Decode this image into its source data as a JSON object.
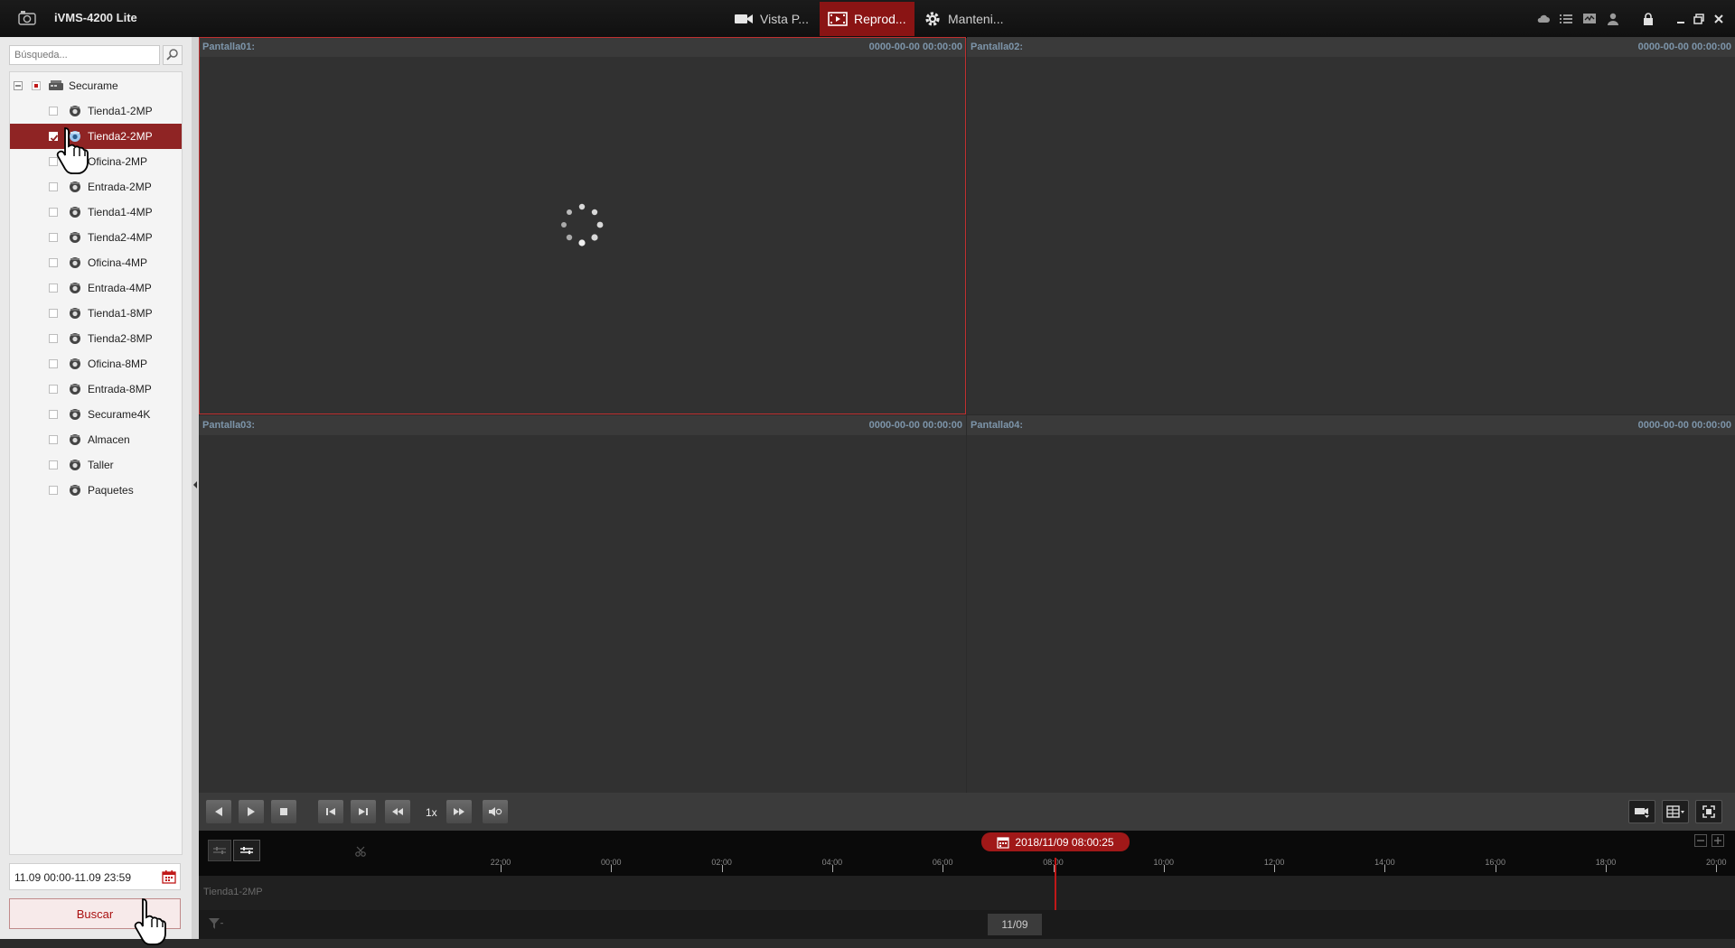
{
  "app": {
    "title": "iVMS-4200 Lite"
  },
  "nav": [
    {
      "label": "Vista P...",
      "icon": "video-camera-icon",
      "active": false
    },
    {
      "label": "Reprod...",
      "icon": "playback-film-icon",
      "active": true
    },
    {
      "label": "Manteni...",
      "icon": "gear-icon",
      "active": false
    }
  ],
  "titlebar_icons": [
    "cloud-icon",
    "list-icon",
    "monitor-icon",
    "user-icon",
    "lock-icon",
    "minimize-icon",
    "restore-icon",
    "close-icon"
  ],
  "search": {
    "placeholder": "Búsqueda...",
    "value": ""
  },
  "tree": {
    "root": "Securame",
    "cameras": [
      {
        "label": "Tienda1-2MP",
        "checked": false,
        "selected": false
      },
      {
        "label": "Tienda2-2MP",
        "checked": true,
        "selected": true
      },
      {
        "label": "Oficina-2MP",
        "checked": false,
        "selected": false
      },
      {
        "label": "Entrada-2MP",
        "checked": false,
        "selected": false
      },
      {
        "label": "Tienda1-4MP",
        "checked": false,
        "selected": false
      },
      {
        "label": "Tienda2-4MP",
        "checked": false,
        "selected": false
      },
      {
        "label": "Oficina-4MP",
        "checked": false,
        "selected": false
      },
      {
        "label": "Entrada-4MP",
        "checked": false,
        "selected": false
      },
      {
        "label": "Tienda1-8MP",
        "checked": false,
        "selected": false
      },
      {
        "label": "Tienda2-8MP",
        "checked": false,
        "selected": false
      },
      {
        "label": "Oficina-8MP",
        "checked": false,
        "selected": false
      },
      {
        "label": "Entrada-8MP",
        "checked": false,
        "selected": false
      },
      {
        "label": "Securame4K",
        "checked": false,
        "selected": false
      },
      {
        "label": "Almacen",
        "checked": false,
        "selected": false
      },
      {
        "label": "Taller",
        "checked": false,
        "selected": false
      },
      {
        "label": "Paquetes",
        "checked": false,
        "selected": false
      }
    ]
  },
  "date_range": "11.09 00:00-11.09 23:59",
  "search_button": "Buscar",
  "panes": [
    {
      "name": "Pantalla01:",
      "time": "0000-00-00 00:00:00",
      "loading": true,
      "active": true
    },
    {
      "name": "Pantalla02:",
      "time": "0000-00-00 00:00:00",
      "loading": false,
      "active": false
    },
    {
      "name": "Pantalla03:",
      "time": "0000-00-00 00:00:00",
      "loading": false,
      "active": false
    },
    {
      "name": "Pantalla04:",
      "time": "0000-00-00 00:00:00",
      "loading": false,
      "active": false
    }
  ],
  "controls": {
    "speed": "1x"
  },
  "timeline": {
    "current": "2018/11/09 08:00:25",
    "ticks": [
      "22:00",
      "00:00",
      "02:00",
      "04:00",
      "06:00",
      "08:00",
      "10:00",
      "12:00",
      "14:00",
      "16:00",
      "18:00",
      "20:00"
    ],
    "track": "Tienda1-2MP",
    "day": "11/09"
  },
  "colors": {
    "accent": "#8a1414",
    "pane_label": "#7d95aa",
    "timeline_cursor": "#c01818"
  }
}
